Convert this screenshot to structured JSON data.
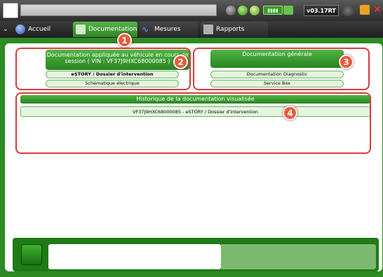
{
  "topbar": {
    "version": "v03.17RT",
    "battery_label": "▮▮▮▮",
    "close_glyph": "✕"
  },
  "tabs": [
    {
      "label": "Accueil",
      "icon": "home-icon"
    },
    {
      "label": "Documentation",
      "icon": "document-icon"
    },
    {
      "label": "Mesures",
      "icon": "waveform-icon"
    },
    {
      "label": "Rapports",
      "icon": "report-icon"
    }
  ],
  "vehicle_doc": {
    "header": "Documentation appliquée au véhicule en cours de session ( VIN : VF37J9HXC68000085 )",
    "items": [
      "eSTORY / Dossier d'intervention",
      "Schématique électrique"
    ]
  },
  "general_doc": {
    "header": "Documentation générale",
    "items": [
      "Documentation Diagnostic",
      "Service Box"
    ]
  },
  "history": {
    "header": "Historique de la documentation visualisée",
    "items": [
      "VF37J9HXC68000085 - eSTORY / Dossier d'intervention"
    ]
  },
  "badges": [
    "1",
    "2",
    "3",
    "4"
  ],
  "colors": {
    "accent_green": "#2d8a25",
    "annotation_red": "#d63c3c",
    "badge_orange": "#e85a3a"
  }
}
